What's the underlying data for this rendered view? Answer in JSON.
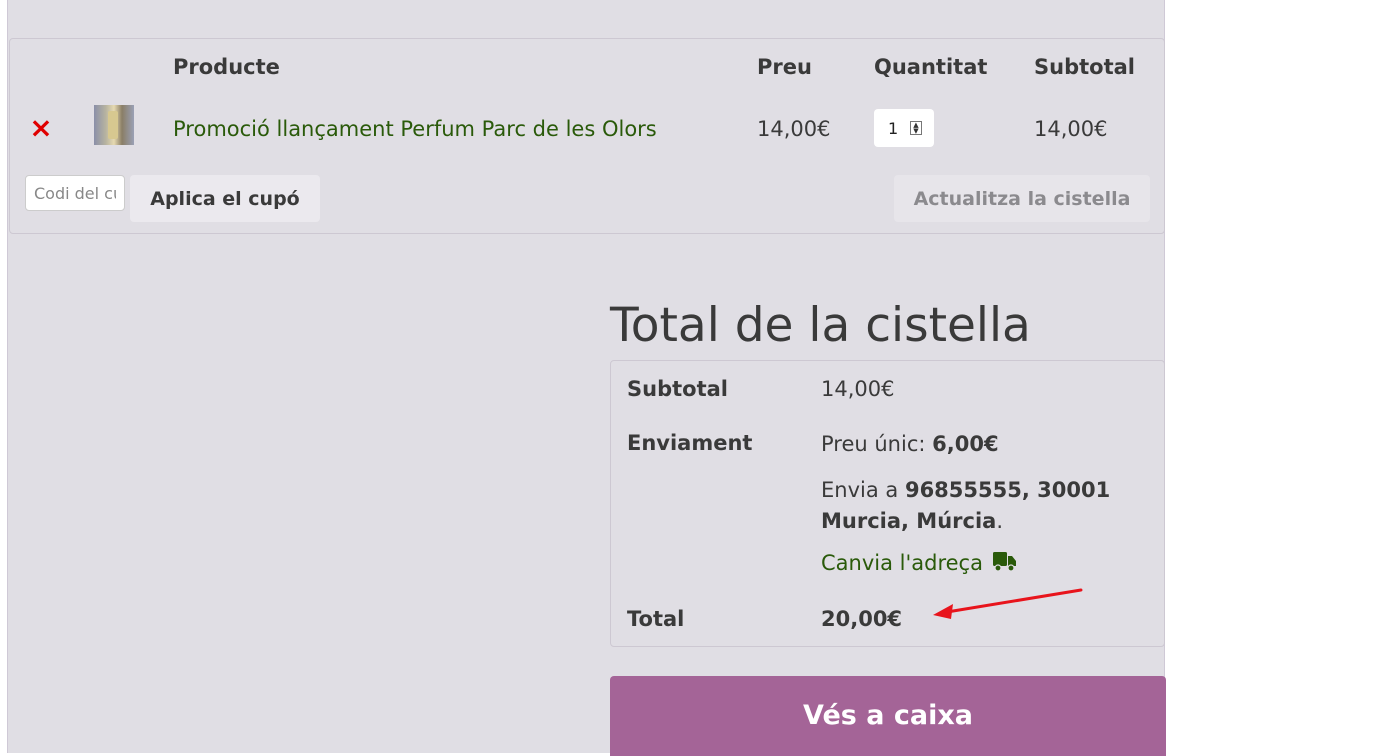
{
  "cart": {
    "headers": {
      "product": "Producte",
      "price": "Preu",
      "quantity": "Quantitat",
      "subtotal": "Subtotal"
    },
    "item": {
      "remove_glyph": "×",
      "name": "Promoció llançament Perfum Parc de les Olors",
      "price": "14,00€",
      "quantity": "1",
      "subtotal": "14,00€"
    },
    "coupon_placeholder": "Codi del cupó",
    "apply_coupon_label": "Aplica el cupó",
    "update_cart_label": "Actualitza la cistella"
  },
  "totals": {
    "title": "Total de la cistella",
    "subtotal_label": "Subtotal",
    "subtotal_value": "14,00€",
    "shipping_label": "Enviament",
    "shipping_method": "Preu únic:",
    "shipping_cost": "6,00€",
    "ship_to_prefix": "Envia a",
    "ship_to_address": "96855555, 30001 Murcia, Múrcia",
    "ship_to_suffix": ".",
    "change_address_label": "Canvia l'adreça",
    "total_label": "Total",
    "total_value": "20,00€"
  },
  "checkout_label": "Vés a caixa",
  "colors": {
    "page_bg": "#e0dee4",
    "link_green": "#2a5a0a",
    "remove_red": "#e00000",
    "checkout_purple": "#a46497",
    "annotation_arrow": "#e8141c"
  }
}
